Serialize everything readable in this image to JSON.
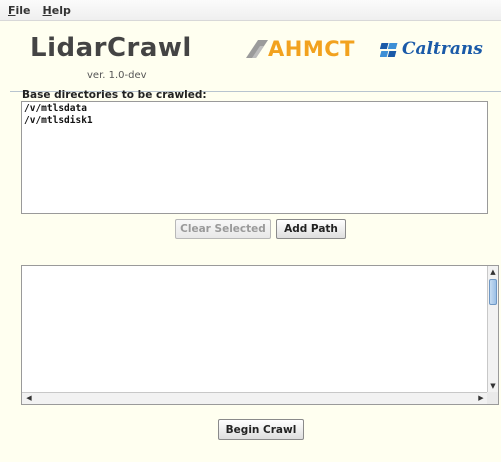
{
  "menu": {
    "file_label": "File",
    "help_label": "Help"
  },
  "app": {
    "title": "LidarCrawl",
    "version": "ver. 1.0-dev"
  },
  "logos": {
    "ahmct_text": "AHMCT",
    "caltrans_text": "Caltrans",
    "ahmct_color": "#f2a21e",
    "caltrans_color": "#1a5aa8"
  },
  "directories": {
    "label": "Base directories to be crawled:",
    "items": [
      "/v/mtlsdata",
      "/v/mtlsdisk1"
    ]
  },
  "buttons": {
    "clear_selected": "Clear Selected",
    "add_path": "Add Path",
    "begin_crawl": "Begin Crawl"
  },
  "log": {
    "content": ""
  }
}
